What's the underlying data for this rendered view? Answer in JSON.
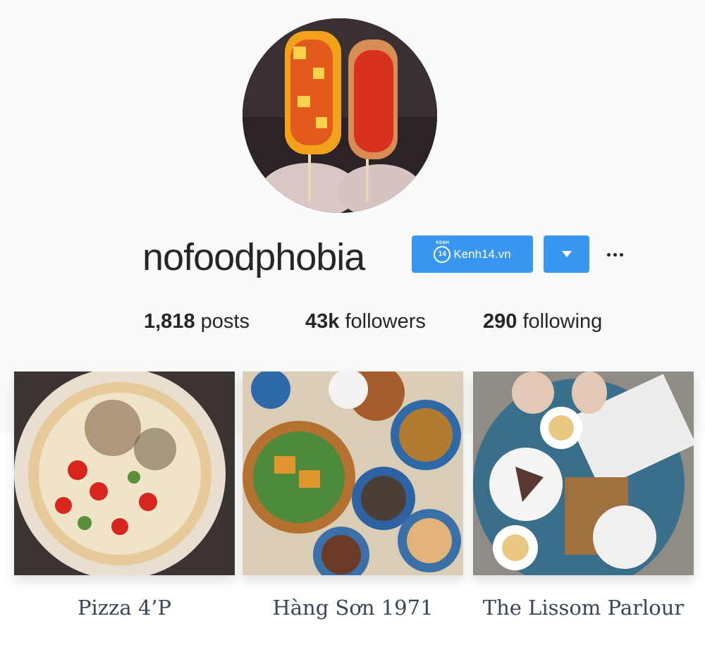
{
  "profile": {
    "username": "nofoodphobia",
    "site_button_label": "Kenh14.vn",
    "site_logo_text": "14",
    "site_logo_top_text": "KENH"
  },
  "stats": {
    "posts_count": "1,818",
    "posts_label": "posts",
    "followers_count": "43k",
    "followers_label": "followers",
    "following_count": "290",
    "following_label": "following"
  },
  "posts": [
    {
      "caption": "Pizza 4’P",
      "icon": "pizza-photo"
    },
    {
      "caption": "Hàng Sơn 1971",
      "icon": "vietnamese-feast-photo"
    },
    {
      "caption": "The Lissom Parlour",
      "icon": "cafe-tea-photo"
    }
  ],
  "colors": {
    "accent": "#3897f0",
    "text": "#262626",
    "caption": "#3a4556",
    "band": "#fafafa"
  }
}
